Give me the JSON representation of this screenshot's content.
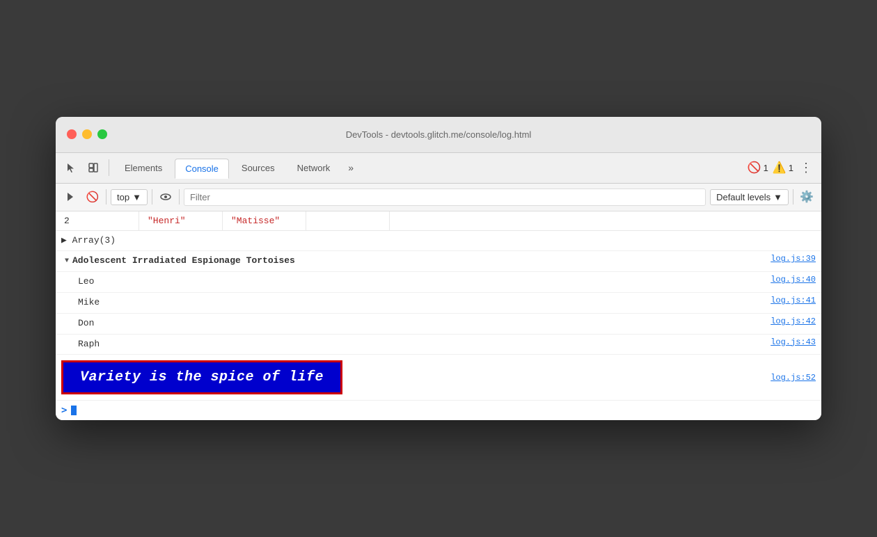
{
  "window": {
    "title": "DevTools - devtools.glitch.me/console/log.html"
  },
  "tabs": [
    {
      "id": "elements",
      "label": "Elements",
      "active": false
    },
    {
      "id": "console",
      "label": "Console",
      "active": true
    },
    {
      "id": "sources",
      "label": "Sources",
      "active": false
    },
    {
      "id": "network",
      "label": "Network",
      "active": false
    }
  ],
  "badge_error_count": "1",
  "badge_warn_count": "1",
  "console_toolbar": {
    "context": "top",
    "filter_placeholder": "Filter",
    "levels_label": "Default levels"
  },
  "table": {
    "row_index": "2",
    "col1": "\"Henri\"",
    "col2": "\"Matisse\""
  },
  "array_label": "▶ Array(3)",
  "group": {
    "label": "Adolescent Irradiated Espionage Tortoises",
    "link": "log.js:39",
    "items": [
      {
        "name": "Leo",
        "link": "log.js:40"
      },
      {
        "name": "Mike",
        "link": "log.js:41"
      },
      {
        "name": "Don",
        "link": "log.js:42"
      },
      {
        "name": "Raph",
        "link": "log.js:43"
      }
    ]
  },
  "styled": {
    "text": "Variety is the spice of life",
    "link": "log.js:52"
  },
  "repl_prompt": ">"
}
